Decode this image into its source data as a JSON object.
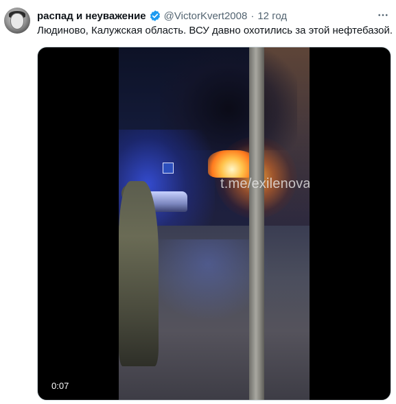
{
  "tweet": {
    "author_name": "распад и неуважение",
    "handle": "@VictorKvert2008",
    "separator": "·",
    "time": "12 год",
    "more_label": "···",
    "text": "Людиново, Калужская область. ВСУ давно охотились за этой нефтебазой."
  },
  "video": {
    "watermark": "t.me/exilenova_plus",
    "timecode": "0:07"
  },
  "colors": {
    "verified_badge": "#1d9bf0",
    "secondary_text": "#536471"
  },
  "icons": {
    "verified": "verified-badge-icon",
    "more": "more-dots-icon"
  }
}
